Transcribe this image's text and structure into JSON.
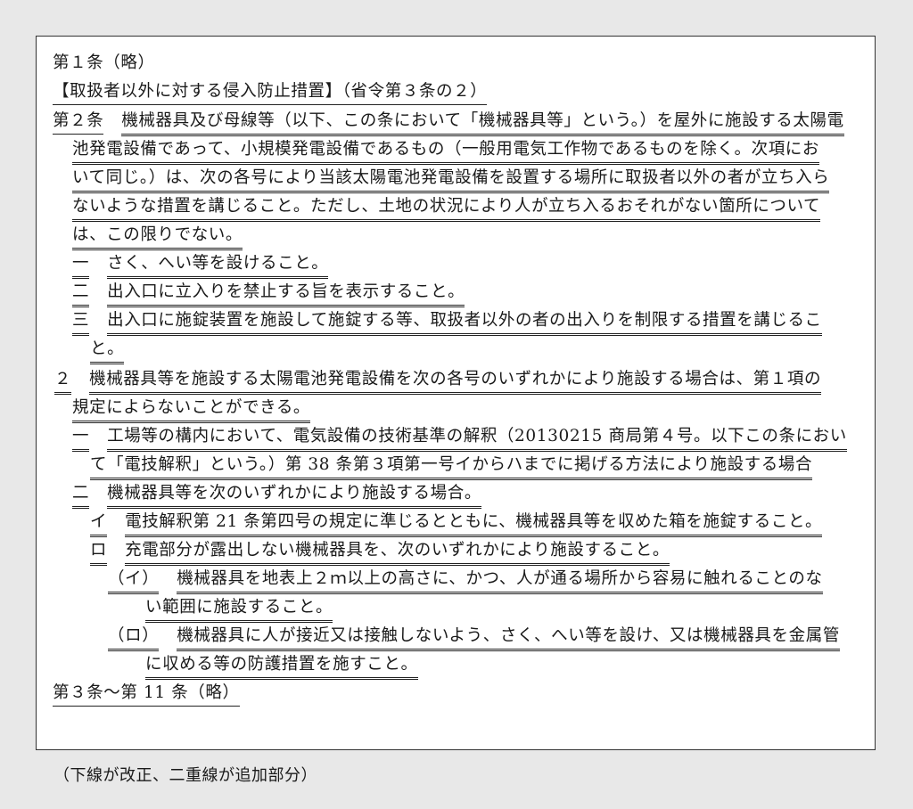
{
  "document": {
    "line01": "第１条（略）",
    "line02": "【取扱者以外に対する侵入防止措置】（省令第３条の２）",
    "line03_label": "第２条",
    "line03": "機械器具及び母線等（以下、この条において「機械器具等」という。）を屋外に施設する太陽電",
    "line04": "池発電設備であって、小規模発電設備であるもの（一般用電気工作物であるものを除く。次項にお",
    "line05": "いて同じ。）は、次の各号により当該太陽電池発電設備を設置する場所に取扱者以外の者が立ち入ら",
    "line06": "ないような措置を講じること。ただし、土地の状況により人が立ち入るおそれがない箇所について",
    "line07": "は、この限りでない。",
    "line08_label": "一",
    "line08": "さく、へい等を設けること。",
    "line09_label": "二",
    "line09": "出入口に立入りを禁止する旨を表示すること。",
    "line10_label": "三",
    "line10": "出入口に施錠装置を施設して施錠する等、取扱者以外の者の出入りを制限する措置を講じるこ",
    "line11": "と。",
    "line12_label": "２",
    "line12": "機械器具等を施設する太陽電池発電設備を次の各号のいずれかにより施設する場合は、第１項の",
    "line13": "規定によらないことができる。",
    "line14_label": "一",
    "line14": "工場等の構内において、電気設備の技術基準の解釈（20130215 商局第４号。以下この条におい",
    "line15": "て「電技解釈」という。）第 38 条第３項第一号イからハまでに掲げる方法により施設する場合",
    "line16_label": "二",
    "line16": "機械器具等を次のいずれかにより施設する場合。",
    "line17_label": "イ",
    "line17": "電技解釈第 21 条第四号の規定に準じるとともに、機械器具等を収めた箱を施錠すること。",
    "line18_label": "ロ",
    "line18": "充電部分が露出しない機械器具を、次のいずれかにより施設すること。",
    "line19_label": "（イ）",
    "line19": "機械器具を地表上２ｍ以上の高さに、かつ、人が通る場所から容易に触れることのな",
    "line20": "い範囲に施設すること。",
    "line21_label": "（ロ）",
    "line21": "機械器具に人が接近又は接触しないよう、さく、へい等を設け、又は機械器具を金属管",
    "line22": "に収める等の防護措置を施すこと。",
    "line23": "第３条〜第 11 条（略）"
  },
  "note": "（下線が改正、二重線が追加部分）"
}
